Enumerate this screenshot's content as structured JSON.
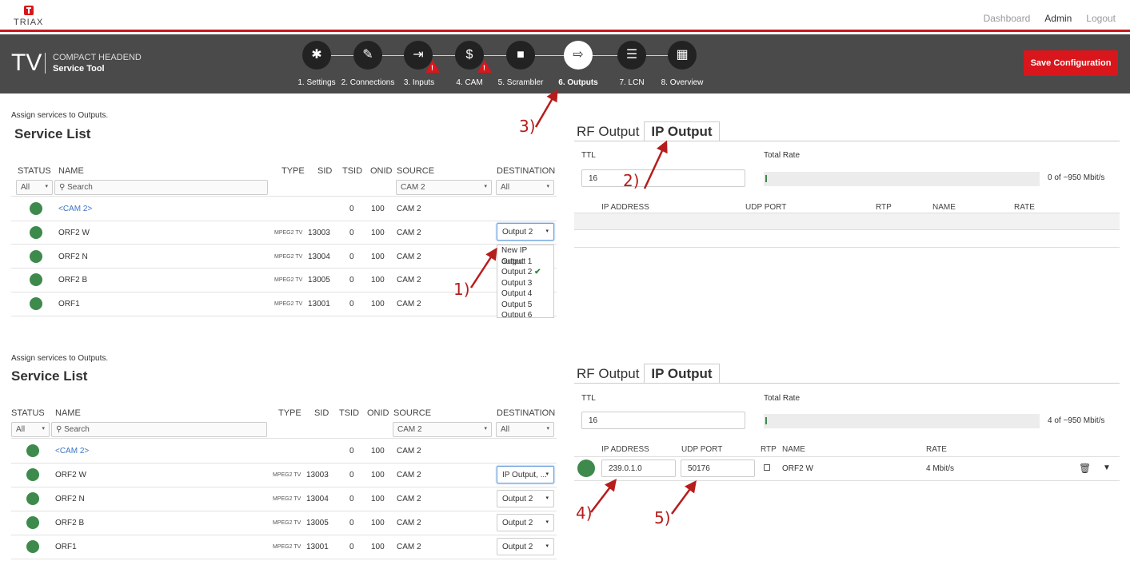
{
  "topbar": {
    "logo_text": "TRIAX",
    "links": [
      "Dashboard",
      "Admin",
      "Logout"
    ]
  },
  "header": {
    "tv": "TV",
    "product_line1": "COMPACT HEADEND",
    "product_line2": "Service Tool",
    "steps": [
      {
        "label": "1. Settings",
        "icon": "gear-icon"
      },
      {
        "label": "2. Connections",
        "icon": "plug-icon"
      },
      {
        "label": "3. Inputs",
        "icon": "sign-in-icon"
      },
      {
        "label": "4. CAM",
        "icon": "dollar-icon"
      },
      {
        "label": "5. Scrambler",
        "icon": "lock-icon"
      },
      {
        "label": "6. Outputs",
        "icon": "sign-out-icon"
      },
      {
        "label": "7. LCN",
        "icon": "list-icon"
      },
      {
        "label": "8. Overview",
        "icon": "grid-icon"
      }
    ],
    "save_label": "Save Configuration"
  },
  "panel1": {
    "hint": "Assign services to Outputs.",
    "title": "Service List",
    "columns": [
      "STATUS",
      "NAME",
      "TYPE",
      "SID",
      "TSID",
      "ONID",
      "SOURCE",
      "DESTINATION"
    ],
    "filter_status": "All",
    "search_placeholder": "Search",
    "filter_source": "CAM 2",
    "filter_dest": "All",
    "rows": [
      {
        "name": "<CAM 2>",
        "type": "",
        "sid": "",
        "tsid": "0",
        "onid": "100",
        "source": "CAM 2",
        "dest": ""
      },
      {
        "name": "ORF2 W",
        "type": "MPEG2 TV",
        "sid": "13003",
        "tsid": "0",
        "onid": "100",
        "source": "CAM 2",
        "dest": "Output 2"
      },
      {
        "name": "ORF2 N",
        "type": "MPEG2 TV",
        "sid": "13004",
        "tsid": "0",
        "onid": "100",
        "source": "CAM 2",
        "dest": ""
      },
      {
        "name": "ORF2 B",
        "type": "MPEG2 TV",
        "sid": "13005",
        "tsid": "0",
        "onid": "100",
        "source": "CAM 2",
        "dest": ""
      },
      {
        "name": "ORF1",
        "type": "MPEG2 TV",
        "sid": "13001",
        "tsid": "0",
        "onid": "100",
        "source": "CAM 2",
        "dest": ""
      }
    ],
    "dropdown_options": [
      "New IP output",
      "Output 1",
      "Output 2",
      "Output 3",
      "Output 4",
      "Output 5",
      "Output 6"
    ],
    "tabs": [
      "RF Output",
      "IP Output"
    ],
    "ttl_label": "TTL",
    "ttl_value": "16",
    "total_rate_label": "Total Rate",
    "rate_text": "0 of ~950 Mbit/s",
    "ip_columns": [
      "IP ADDRESS",
      "UDP PORT",
      "RTP",
      "NAME",
      "RATE"
    ]
  },
  "panel2": {
    "hint": "Assign services to Outputs.",
    "title": "Service List",
    "columns": [
      "STATUS",
      "NAME",
      "TYPE",
      "SID",
      "TSID",
      "ONID",
      "SOURCE",
      "DESTINATION"
    ],
    "filter_status": "All",
    "search_placeholder": "Search",
    "filter_source": "CAM 2",
    "filter_dest": "All",
    "rows": [
      {
        "name": "<CAM 2>",
        "type": "",
        "sid": "",
        "tsid": "0",
        "onid": "100",
        "source": "CAM 2",
        "dest": ""
      },
      {
        "name": "ORF2 W",
        "type": "MPEG2 TV",
        "sid": "13003",
        "tsid": "0",
        "onid": "100",
        "source": "CAM 2",
        "dest": "IP Output, ..."
      },
      {
        "name": "ORF2 N",
        "type": "MPEG2 TV",
        "sid": "13004",
        "tsid": "0",
        "onid": "100",
        "source": "CAM 2",
        "dest": "Output 2"
      },
      {
        "name": "ORF2 B",
        "type": "MPEG2 TV",
        "sid": "13005",
        "tsid": "0",
        "onid": "100",
        "source": "CAM 2",
        "dest": "Output 2"
      },
      {
        "name": "ORF1",
        "type": "MPEG2 TV",
        "sid": "13001",
        "tsid": "0",
        "onid": "100",
        "source": "CAM 2",
        "dest": "Output 2"
      }
    ],
    "tabs": [
      "RF Output",
      "IP Output"
    ],
    "ttl_label": "TTL",
    "ttl_value": "16",
    "total_rate_label": "Total Rate",
    "rate_text": "4 of ~950 Mbit/s",
    "ip_columns": [
      "IP ADDRESS",
      "UDP PORT",
      "RTP",
      "NAME",
      "RATE"
    ],
    "ip_row": {
      "ip": "239.0.1.0",
      "port": "50176",
      "name": "ORF2 W",
      "rate": "4 Mbit/s"
    }
  },
  "annotations": [
    "1)",
    "2)",
    "3)",
    "4)",
    "5)"
  ],
  "colors": {
    "brand_red": "#d8161b",
    "header_bg": "#4a4a4a",
    "status_green": "#3d8a4c",
    "link_blue": "#3b73c5",
    "annotation_red": "#b71c1c"
  }
}
